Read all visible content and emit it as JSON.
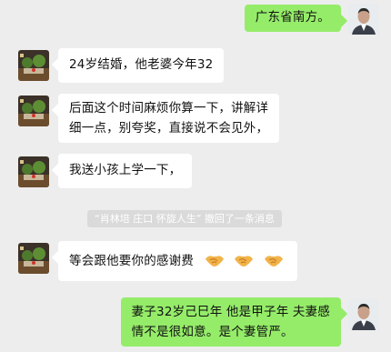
{
  "messages": [
    {
      "side": "right",
      "text": "广东省南方。"
    },
    {
      "side": "left",
      "text": "24岁结婚，他老婆今年32"
    },
    {
      "side": "left",
      "lines": [
        "后面这个时间麻烦你算一下，讲解详",
        "细一点，别夸奖，直接说不会见外，"
      ]
    },
    {
      "side": "left",
      "text": "我送小孩上学一下，"
    },
    {
      "side": "left",
      "text": "等会跟他要你的感谢费",
      "emojis": [
        "handshake-emoji",
        "handshake-emoji",
        "handshake-emoji"
      ]
    },
    {
      "side": "right",
      "lines": [
        "妻子32岁己巳年  他是甲子年  夫妻感",
        "情不是很如意。是个妻管严。"
      ]
    }
  ],
  "recall_notice": "“肖林培  庄口    怀旋人生”  撤回了一条消息",
  "colors": {
    "self_bubble": "#95ec69",
    "other_bubble": "#ffffff",
    "background": "#ededed"
  }
}
